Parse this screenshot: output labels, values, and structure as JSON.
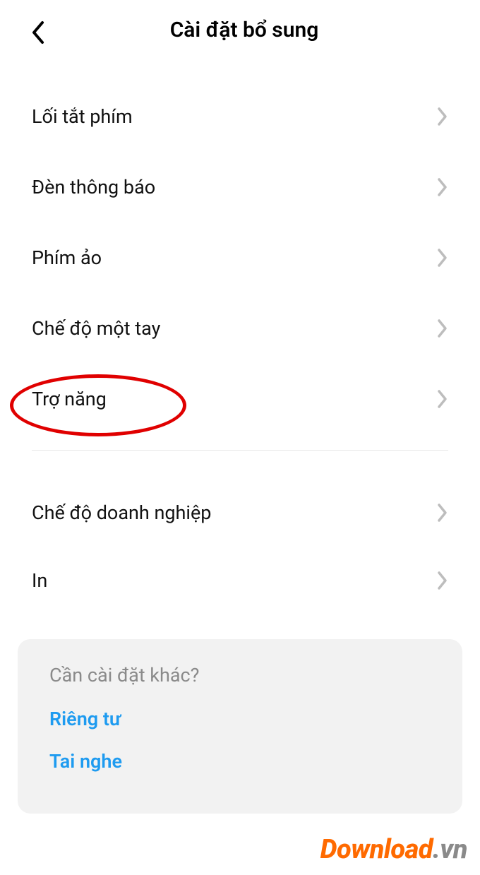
{
  "header": {
    "title": "Cài đặt bổ sung"
  },
  "items": [
    {
      "label": "Lối tắt phím"
    },
    {
      "label": "Đèn thông báo"
    },
    {
      "label": "Phím ảo"
    },
    {
      "label": "Chế độ một tay"
    },
    {
      "label": "Trợ năng"
    },
    {
      "label": "Chế độ doanh nghiệp"
    },
    {
      "label": "In"
    }
  ],
  "suggestion": {
    "title": "Cần cài đặt khác?",
    "links": [
      {
        "label": "Riêng tư"
      },
      {
        "label": "Tai nghe"
      }
    ]
  },
  "watermark": {
    "part1": "Download",
    "part2": ".vn"
  }
}
